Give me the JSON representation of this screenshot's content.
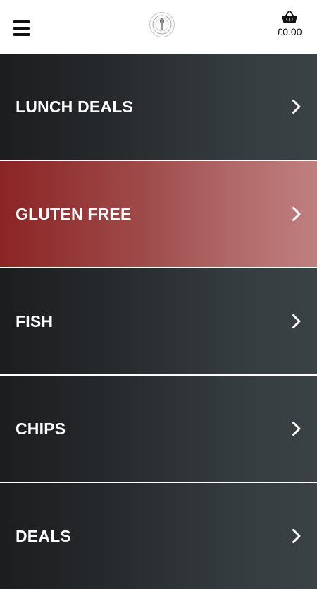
{
  "header": {
    "menu_icon": "hamburger-menu-icon",
    "logo_icon": "restaurant-logo-icon",
    "cart_icon": "basket-icon",
    "cart_total": "£0.00"
  },
  "categories": [
    {
      "label": "LUNCH DEALS",
      "highlighted": false
    },
    {
      "label": "GLUTEN FREE",
      "highlighted": true
    },
    {
      "label": "FISH",
      "highlighted": false
    },
    {
      "label": "CHIPS",
      "highlighted": false
    },
    {
      "label": "DEALS",
      "highlighted": false
    }
  ],
  "colors": {
    "highlight": "#9f3a3a",
    "dark_tile": "#2a2e30"
  }
}
